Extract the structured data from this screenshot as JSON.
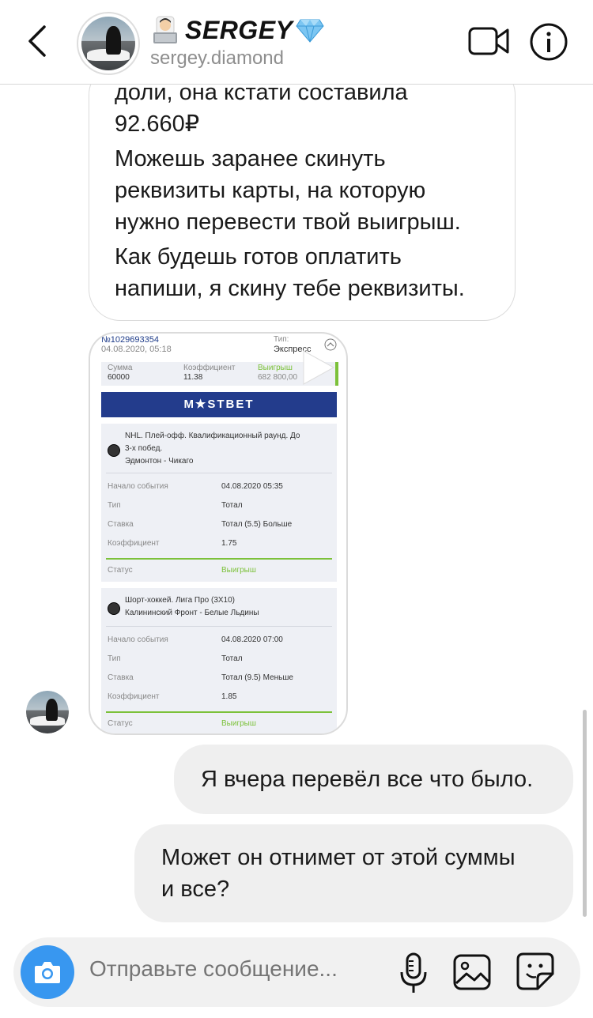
{
  "header": {
    "name": "SERGEY",
    "username": "sergey.diamond",
    "icons": [
      "back-chevron-icon",
      "laptop-person-emoji",
      "diamond-emoji",
      "video-call-icon",
      "info-icon"
    ]
  },
  "messages": {
    "incoming_text": [
      "доли, она кстати составила",
      "92.660₽",
      "Можешь заранее скинуть",
      "реквизиты карты, на которую",
      "нужно перевести твой выигрыш.",
      "Как будешь готов оплатить",
      "напиши, я скину тебе реквизиты."
    ],
    "outgoing_1": "Я вчера перевёл все что было.",
    "outgoing_2_lines": [
      "Может он отнимет от этой суммы",
      "и все?"
    ]
  },
  "bet_screenshot": {
    "ticket_id": "№1029693354",
    "ticket_date": "04.08.2020, 05:18",
    "type_label": "Тип:",
    "type_value": "Экспресс",
    "sum_label": "Сумма",
    "sum_value": "60000",
    "coef_label": "Коэффициент",
    "coef_value": "11.38",
    "win_label": "Выигрыш",
    "win_value": "682 800,00",
    "brand": "M★STBET",
    "events": [
      {
        "title_l1": "NHL. Плей-офф. Квалификационный раунд. До",
        "title_l2": "3-х побед.",
        "title_l3": "Эдмонтон - Чикаго",
        "start_label": "Начало события",
        "start_value": "04.08.2020 05:35",
        "type_label": "Тип",
        "type_value": "Тотал",
        "stake_label": "Ставка",
        "stake_value": "Тотал (5.5) Больше",
        "coef_label": "Коэффициент",
        "coef_value": "1.75",
        "status_label": "Статус",
        "status_value": "Выигрыш"
      },
      {
        "title_l1": "Шорт-хоккей. Лига Про (3Х10)",
        "title_l2": "Калининский Фронт - Белые Льдины",
        "start_label": "Начало события",
        "start_value": "04.08.2020 07:00",
        "type_label": "Тип",
        "type_value": "Тотал",
        "stake_label": "Ставка",
        "stake_value": "Тотал (9.5) Меньше",
        "coef_label": "Коэффициент",
        "coef_value": "1.85",
        "status_label": "Статус",
        "status_value": "Выигрыш"
      }
    ]
  },
  "composer": {
    "placeholder": "Отправьте сообщение...",
    "icons": [
      "camera-icon",
      "microphone-icon",
      "gallery-icon",
      "sticker-icon"
    ]
  },
  "colors": {
    "accent": "#3897f0",
    "win_green": "#7cc13a",
    "brand_blue": "#233c8c",
    "bubble_out": "#efefef"
  }
}
